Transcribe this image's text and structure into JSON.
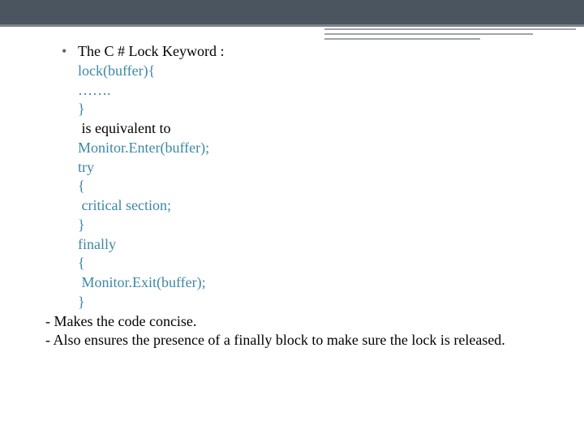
{
  "bullet": {
    "heading": "The C # Lock Keyword :",
    "blank1": "",
    "code1_l1": "lock(buffer){",
    "code1_l2": "…….",
    "code1_l3": "}",
    "blank2": "",
    "equiv": " is equivalent to",
    "blank3": "",
    "code2_l1": "Monitor.Enter(buffer);",
    "code2_l2": "try",
    "code2_l3": "{",
    "code2_l4": " critical section;",
    "code2_l5": "}",
    "code2_l6": "finally",
    "code2_l7": "{",
    "code2_l8": " Monitor.Exit(buffer);",
    "code2_l9": "}"
  },
  "notes": {
    "n1": "- Makes the code concise.",
    "n2": "- Also ensures the presence of a finally block to make sure the lock is released."
  }
}
